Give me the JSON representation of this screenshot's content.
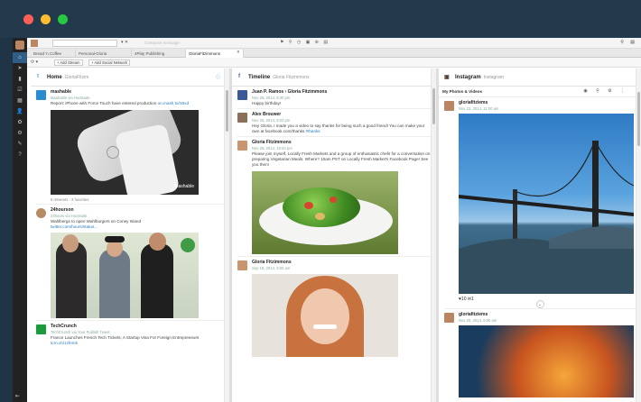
{
  "topbar": {
    "search_placeholder": "Compose message"
  },
  "tabs": [
    {
      "label": "Bread 'n Coffee"
    },
    {
      "label": "Personal-Gloria"
    },
    {
      "label": "4Play Publishing"
    },
    {
      "label": "GloriaFitzimmons"
    }
  ],
  "subbar": {
    "add_stream": "Add Stream",
    "add_network": "Add Social Network"
  },
  "columns": {
    "home": {
      "title": "Home",
      "subtitle": "GloriaFitzim",
      "posts": [
        {
          "author": "mashable",
          "meta": "Mashable via Hootsuite",
          "text": "Report: iPhone with Force Touch have entered production",
          "link": "on.mash.to/1Bxd",
          "counts": "6 retweets · 3 favorites",
          "img_label": "Mashable"
        },
        {
          "author": "24hourson",
          "meta": "24hours via Hootsuite",
          "text": "Wahlbergs to open Wahlburgers on Coney Island",
          "link": "twitter.com/hours/status...",
          "counts": ""
        },
        {
          "author": "TechCrunch",
          "meta": "TechCrunch via Your Publish Tweet",
          "text": "France Launches French Tech Tickets, A Startup Visa For Foreign Entrepreneurs",
          "link": "tcrn.ch/1zfemk",
          "counts": ""
        }
      ]
    },
    "timeline": {
      "title": "Timeline",
      "subtitle": "Gloria Fitzimmons",
      "posts": [
        {
          "author": "Juan P. Ramos › Gloria Fitzimmons",
          "meta": "Nov 25, 2014, 8:30 pm",
          "text": "Happy birthday!"
        },
        {
          "author": "Alex Brouwer",
          "meta": "Nov 25, 2014, 8:02 pm",
          "text": "Hey Gloria, I made you a video to say thanks for being such a good friend! You can make your own at facebook.com/thanks",
          "link": "#thanks"
        },
        {
          "author": "Gloria Fitzimmons",
          "meta": "Nov 25, 2014, 10:44 pm",
          "text": "Please join myself, Locally Fresh Markets and a group of enthusiastic chefs for a conversation on preparing Vegetarian Meals. Where? 10am PST on Locally Fresh Market's Facebook Page! See you then!"
        },
        {
          "author": "Gloria Fitzimmons",
          "meta": "Sep 18, 2014, 9:00 am",
          "text": ""
        }
      ]
    },
    "instagram": {
      "title": "Instagram",
      "subtitle": "Instagram",
      "section": "My Photos & Videos",
      "posts": [
        {
          "author": "gloriafitziems",
          "meta": "Nov 22, 2014, 11:00 am",
          "likes": "10",
          "comments": "1"
        },
        {
          "author": "gloriafitziems",
          "meta": "Nov 20, 2014, 9:00 am"
        }
      ]
    }
  },
  "colors": {
    "accent": "#2f5d86",
    "facebook": "#3b5998",
    "twitter": "#4ba3e0",
    "dot_red": "#ff5f57",
    "dot_yellow": "#febc2e",
    "dot_green": "#28c840"
  }
}
